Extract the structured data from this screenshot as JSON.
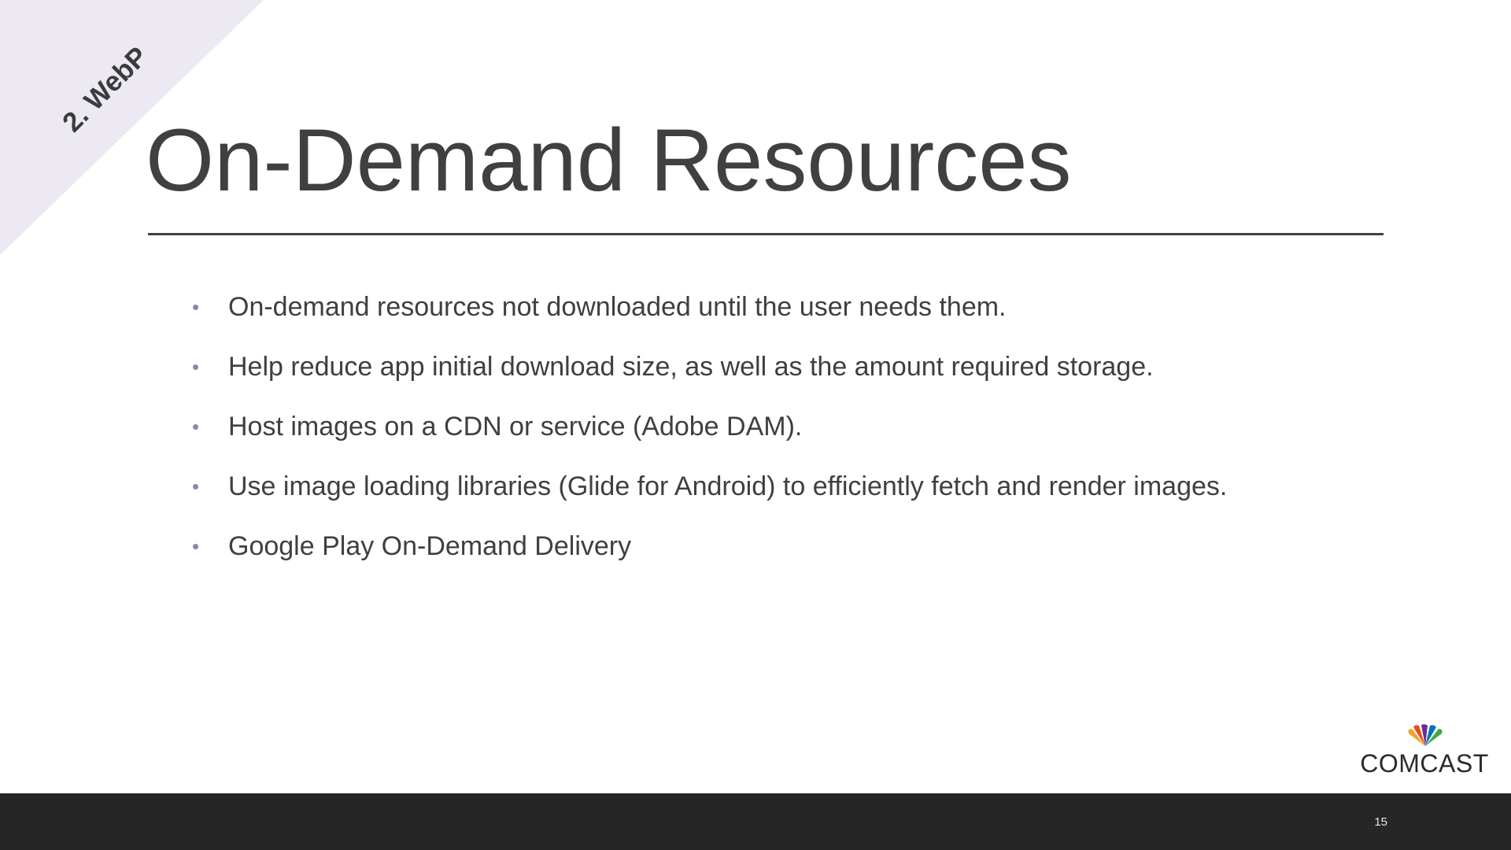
{
  "section_tag": "2. WebP",
  "slide": {
    "title": "On-Demand Resources",
    "bullets": [
      "On-demand resources not downloaded until the user needs them.",
      "Help reduce app initial download size, as well as the amount required storage.",
      "Host images on a CDN or service (Adobe DAM).",
      "Use image loading libraries (Glide for Android) to efficiently fetch and render images.",
      "Google Play On-Demand Delivery"
    ],
    "bullet_glyph": "•"
  },
  "logo": {
    "wordmark": "COMCAST",
    "icon": "peacock-icon"
  },
  "footer": {
    "page_number": "15"
  },
  "colors": {
    "corner_banner": "#ece9f3",
    "title_text": "#404040",
    "bullet_marker": "#8b86ad",
    "footer_bar": "#262626",
    "peacock": [
      "#f5a623",
      "#e94e1b",
      "#c8102e",
      "#6a2c91",
      "#0072bc",
      "#47a447"
    ]
  }
}
